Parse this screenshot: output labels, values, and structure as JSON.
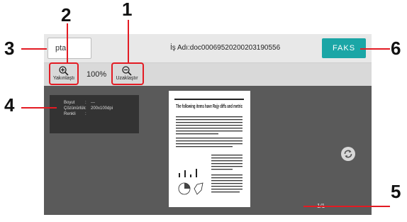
{
  "header": {
    "cancel_label": "İptal",
    "cancel_visible_text": "ptal",
    "job_name": "İş Adı:doc00069520200203190556",
    "fax_label": "FAKS"
  },
  "toolbar": {
    "zoom_in_label": "Yakınlaştır",
    "zoom_in_visible_text": "Yakınlaştı",
    "zoom_level": "100%",
    "zoom_out_label": "Uzaklaştır"
  },
  "info": {
    "rows": [
      {
        "key": "Boyut",
        "value": "---"
      },
      {
        "key": "Çözünürlük",
        "value": "200x100dpi"
      },
      {
        "key": "Renkli",
        "value": ""
      }
    ]
  },
  "preview": {
    "heading": "The following items have Rajy diffs and metric",
    "page_counter": "1/1"
  },
  "callouts": [
    "1",
    "2",
    "3",
    "4",
    "5",
    "6"
  ],
  "colors": {
    "accent": "#1ba6a6",
    "callout_line": "#e31b23",
    "preview_bg": "#5a5a5a"
  }
}
